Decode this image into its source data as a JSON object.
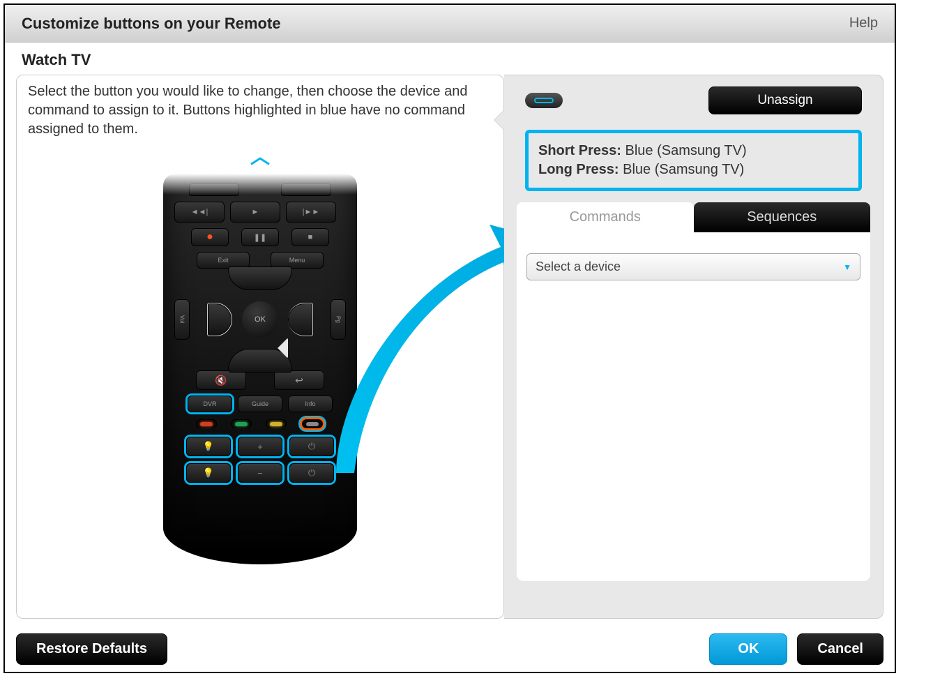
{
  "titlebar": {
    "title": "Customize buttons on your Remote",
    "help": "Help"
  },
  "subtitle": "Watch TV",
  "instructions": "Select the button you would like to change, then choose the device and command to assign to it. Buttons highlighted in blue have no command assigned to them.",
  "remote": {
    "top_left": "",
    "top_right": "",
    "rewind": "◄◄|",
    "play": "►",
    "forward": "|►►",
    "record": "●",
    "pause": "❚❚",
    "stop": "■",
    "exit": "Exit",
    "menu": "Menu",
    "vol": "Vol",
    "ok": "OK",
    "pg": "Pg",
    "mute": "🔇",
    "back": "↩",
    "dvr": "DVR",
    "guide": "Guide",
    "info": "Info",
    "bulb1": "💡",
    "plus": "+",
    "power1": "⏻",
    "bulb2": "💡",
    "minus": "−",
    "power2": "⏻"
  },
  "right_panel": {
    "unassign": "Unassign",
    "short_press_label": "Short Press:",
    "short_press_value": "Blue (Samsung TV)",
    "long_press_label": "Long Press:",
    "long_press_value": "Blue (Samsung TV)",
    "tab_commands": "Commands",
    "tab_sequences": "Sequences",
    "device_select": "Select a device"
  },
  "footer": {
    "restore": "Restore Defaults",
    "ok": "OK",
    "cancel": "Cancel"
  }
}
